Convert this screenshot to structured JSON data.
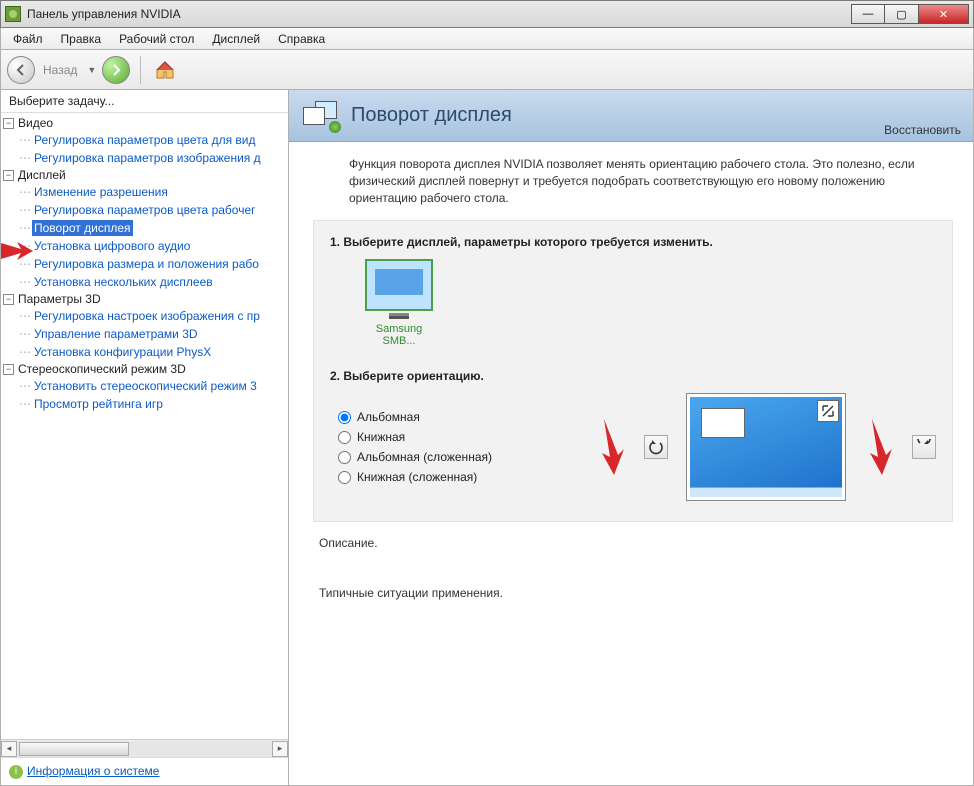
{
  "window": {
    "title": "Панель управления NVIDIA"
  },
  "menu": {
    "file": "Файл",
    "edit": "Правка",
    "desktop": "Рабочий стол",
    "display": "Дисплей",
    "help": "Справка"
  },
  "toolbar": {
    "back": "Назад"
  },
  "sidebar": {
    "header": "Выберите задачу...",
    "video": {
      "label": "Видео",
      "items": [
        "Регулировка параметров цвета для вид",
        "Регулировка параметров изображения д"
      ]
    },
    "display": {
      "label": "Дисплей",
      "items": [
        "Изменение разрешения",
        "Регулировка параметров цвета рабочег",
        "Поворот дисплея",
        "Установка цифрового аудио",
        "Регулировка размера и положения рабо",
        "Установка нескольких дисплеев"
      ]
    },
    "params3d": {
      "label": "Параметры 3D",
      "items": [
        "Регулировка настроек изображения с пр",
        "Управление параметрами 3D",
        "Установка конфигурации PhysX"
      ]
    },
    "stereo": {
      "label": "Стереоскопический режим 3D",
      "items": [
        "Установить стереоскопический режим 3",
        "Просмотр рейтинга игр"
      ]
    },
    "sysinfo": "Информация о системе"
  },
  "content": {
    "title": "Поворот дисплея",
    "restore": "Восстановить",
    "description": "Функция поворота дисплея NVIDIA позволяет менять ориентацию рабочего стола. Это полезно, если физический дисплей повернут и требуется подобрать соответствующую его новому положению ориентацию рабочего стола.",
    "step1": "1. Выберите дисплей, параметры которого требуется изменить.",
    "display_name": "Samsung SMB...",
    "step2": "2. Выберите ориентацию.",
    "orientations": [
      "Альбомная",
      "Книжная",
      "Альбомная (сложенная)",
      "Книжная (сложенная)"
    ],
    "desc_label": "Описание.",
    "usage_label": "Типичные ситуации применения."
  }
}
